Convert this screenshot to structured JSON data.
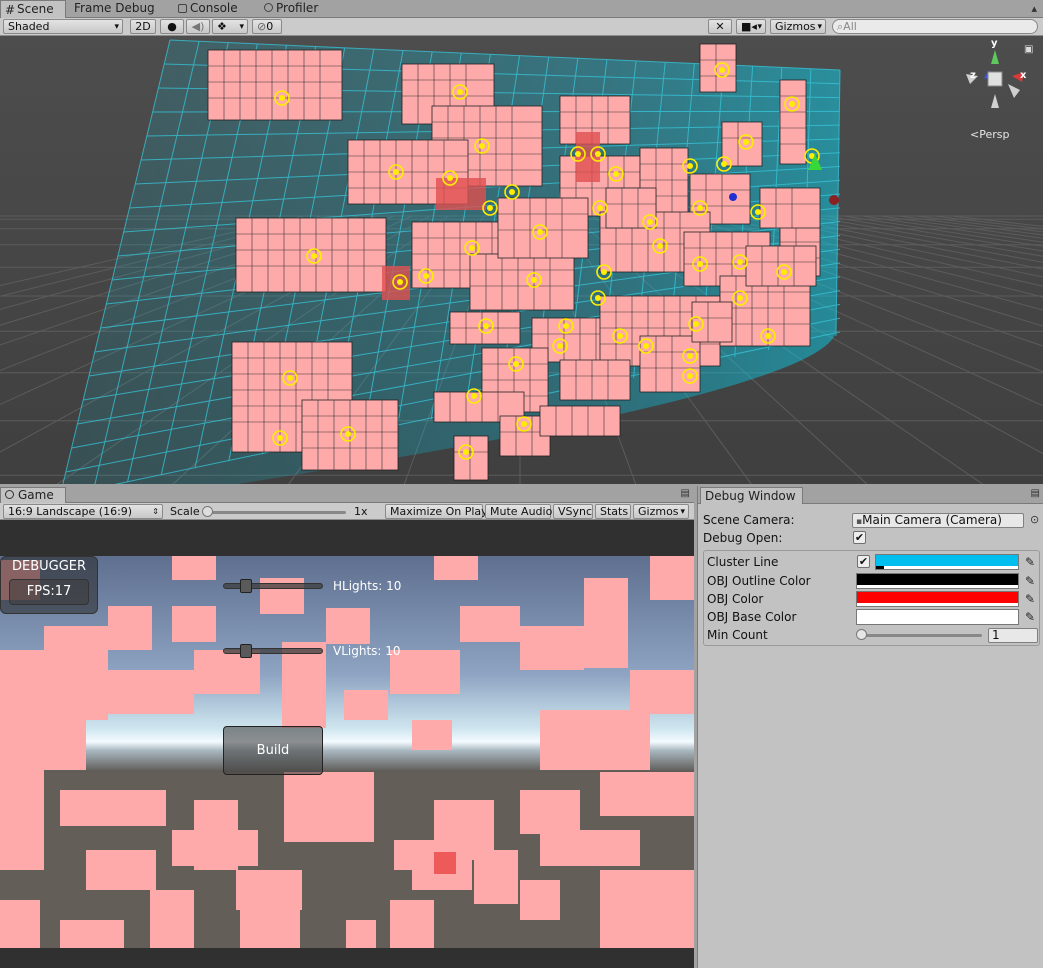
{
  "scene_tabs": [
    {
      "label": "Scene",
      "active": true
    },
    {
      "label": "Frame Debug",
      "active": false
    },
    {
      "label": "Console",
      "active": false
    },
    {
      "label": "Profiler",
      "active": false
    }
  ],
  "scene_toolbar": {
    "shading_mode": "Shaded",
    "mode_2d": "2D",
    "hidden_count": "0",
    "gizmos_label": "Gizmos",
    "search_placeholder": "All"
  },
  "scene_gizmo": {
    "axis_y": "y",
    "axis_x": "x",
    "axis_z": "z",
    "projection": "Persp"
  },
  "game_tab": {
    "label": "Game"
  },
  "game_toolbar": {
    "aspect": "16:9 Landscape (16:9)",
    "scale_label": "Scale",
    "scale_value": "1x",
    "maximize_on_play": "Maximize On Play",
    "mute_audio": "Mute Audio",
    "vsync": "VSync",
    "stats": "Stats",
    "gizmos": "Gizmos"
  },
  "game_ui": {
    "debugger_title": "DEBUGGER",
    "fps_text": "FPS:17",
    "hlights_label": "HLights: 10",
    "hlights_value": 10,
    "vlights_label": "VLights: 10",
    "vlights_value": 10,
    "build_button": "Build"
  },
  "debug_window": {
    "tab_label": "Debug Window",
    "scene_camera_label": "Scene Camera:",
    "scene_camera_value": "Main Camera (Camera)",
    "debug_open_label": "Debug Open:",
    "debug_open_checked": true,
    "cluster_line_label": "Cluster Line",
    "cluster_line_checked": true,
    "cluster_line_color": "#00bfee",
    "obj_outline_color_label": "OBJ Outline Color",
    "obj_outline_color": "#000000",
    "obj_color_label": "OBJ Color",
    "obj_color": "#ff0000",
    "obj_base_color_label": "OBJ Base Color",
    "obj_base_color": "#ffffff",
    "min_count_label": "Min Count",
    "min_count_value": "1"
  },
  "colors": {
    "pink": "#ffaaaa",
    "cyan": "#00d8ff",
    "light_yellow": "#ffee00"
  }
}
